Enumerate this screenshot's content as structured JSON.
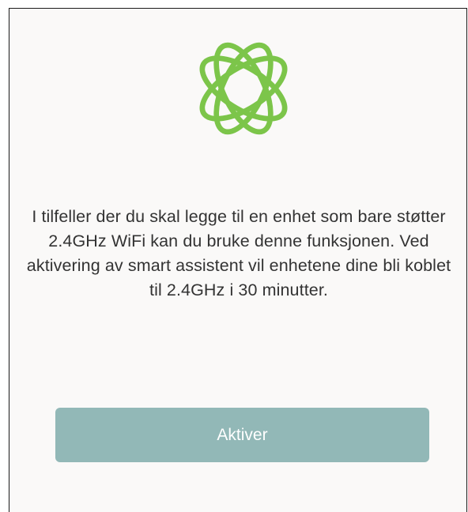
{
  "colors": {
    "background": "#faf9f8",
    "icon_green": "#7cc54a",
    "button_bg": "#92b8b7",
    "button_text": "#ffffff",
    "body_text": "#333333"
  },
  "icon": {
    "name": "orbit-atom-icon"
  },
  "main": {
    "description": "I tilfeller der du skal legge til en enhet som bare støtter 2.4GHz WiFi kan du bruke denne funksjonen. Ved aktivering av smart assistent vil enhetene dine bli koblet til 2.4GHz i 30 minutter."
  },
  "actions": {
    "activate_label": "Aktiver"
  }
}
